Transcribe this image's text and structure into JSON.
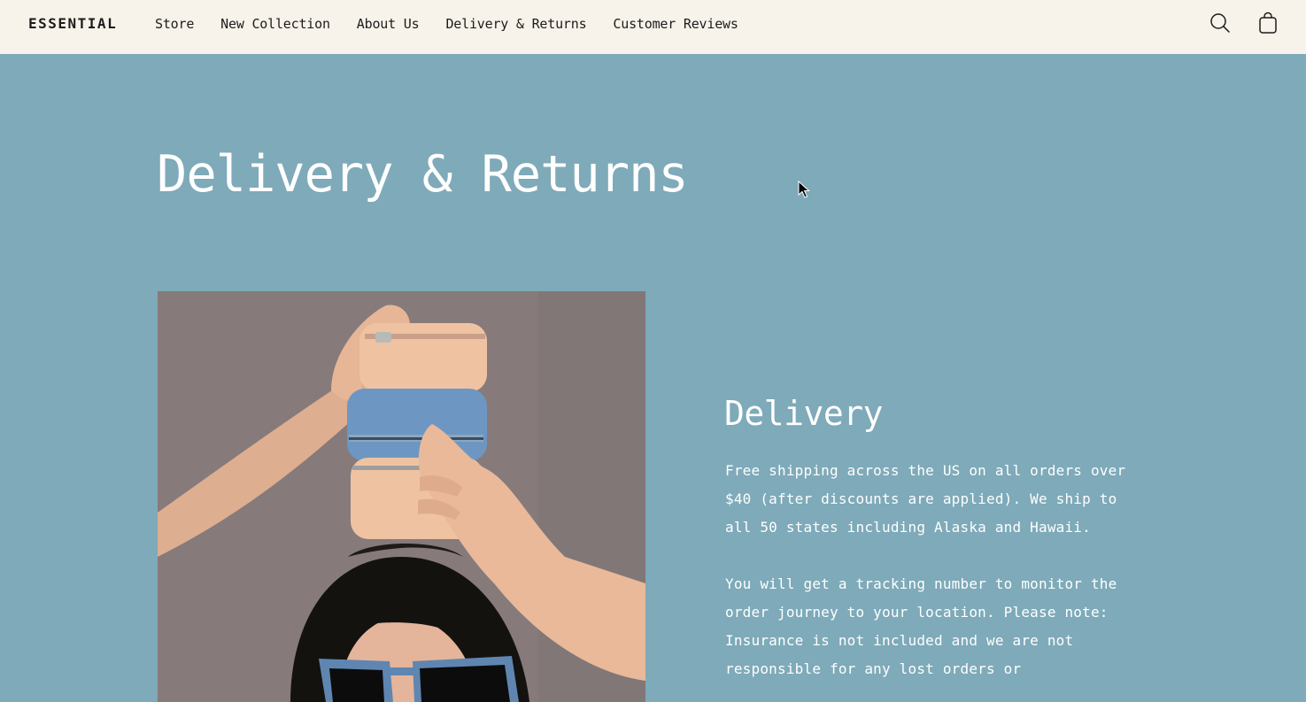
{
  "header": {
    "logo": "ESSENTIAL",
    "nav": [
      {
        "label": "Store"
      },
      {
        "label": "New Collection"
      },
      {
        "label": "About Us"
      },
      {
        "label": "Delivery & Returns"
      },
      {
        "label": "Customer Reviews"
      }
    ],
    "icons": [
      "search-icon",
      "shopping-bag-icon"
    ]
  },
  "main": {
    "title": "Delivery & Returns",
    "section": {
      "heading": "Delivery",
      "paragraphs": [
        "Free shipping across the US on all orders over $40 (after discounts are applied). We ship to all 50 states including Alaska and Hawaii.",
        "You will get a tracking number to monitor the order journey to your location. Please note: Insurance is not included and we are not responsible for any lost orders or"
      ]
    }
  },
  "colors": {
    "header_bg": "#f7f3ea",
    "page_bg": "#7eaab9",
    "text_dark": "#1c1c1c",
    "text_light": "#ffffff"
  }
}
